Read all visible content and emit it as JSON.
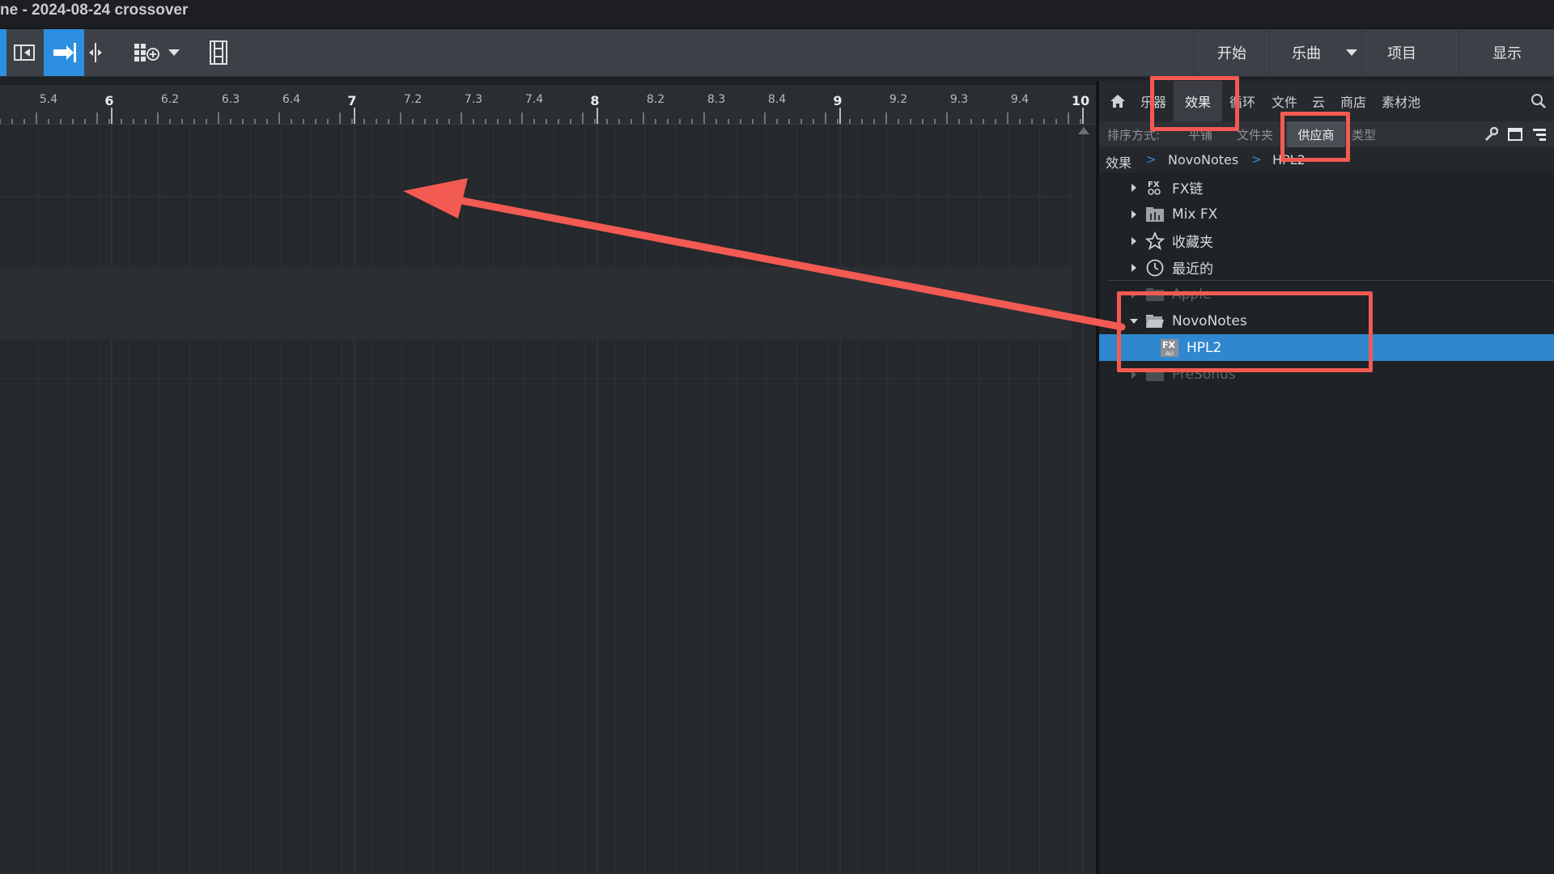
{
  "window": {
    "title": "ne - 2024-08-24 crossover"
  },
  "toolbar": {
    "right_buttons": [
      {
        "label": "开始"
      },
      {
        "label": "乐曲"
      },
      {
        "label": "项目"
      },
      {
        "label": "显示"
      }
    ]
  },
  "ruler": {
    "labels": [
      "5.4",
      "6",
      "6.2",
      "6.3",
      "6.4",
      "7",
      "7.2",
      "7.3",
      "7.4",
      "8",
      "8.2",
      "8.3",
      "8.4",
      "9",
      "9.2",
      "9.3",
      "9.4",
      "10"
    ]
  },
  "browser": {
    "tabs": [
      {
        "label": "乐器"
      },
      {
        "label": "效果",
        "selected": true
      },
      {
        "label": "循环"
      },
      {
        "label": "文件"
      },
      {
        "label": "云"
      },
      {
        "label": "商店"
      },
      {
        "label": "素材池"
      }
    ],
    "sort": {
      "label": "排序方式:",
      "options": [
        {
          "label": "平铺"
        },
        {
          "label": "文件夹"
        },
        {
          "label": "供应商",
          "selected": true
        },
        {
          "label": "类型"
        }
      ]
    },
    "breadcrumb": [
      "效果",
      "NovoNotes",
      "HPL2"
    ],
    "tree": [
      {
        "label": "FX链",
        "icon": "fx-chain-icon",
        "expanded": false
      },
      {
        "label": "Mix FX",
        "icon": "mixer-folder-icon",
        "expanded": false
      },
      {
        "label": "收藏夹",
        "icon": "star-icon",
        "expanded": false
      },
      {
        "label": "最近的",
        "icon": "clock-icon",
        "expanded": false
      },
      {
        "label": "Apple",
        "icon": "folder-icon",
        "expanded": false
      },
      {
        "label": "NovoNotes",
        "icon": "folder-open-icon",
        "expanded": true
      },
      {
        "label": "HPL2",
        "icon": "fx-au-icon",
        "selected": true
      },
      {
        "label": "PreSonus",
        "icon": "vendor-icon",
        "expanded": false
      }
    ]
  },
  "colors": {
    "accent": "#2f87cf",
    "annotation": "#f25a52"
  }
}
